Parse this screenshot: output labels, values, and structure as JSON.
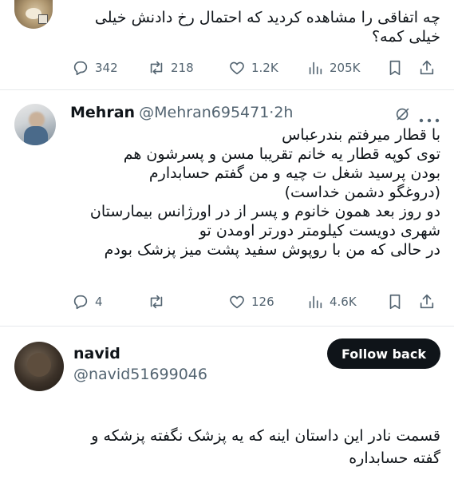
{
  "tweet1": {
    "text_line1": "چه اتفاقی را مشاهده کردید که احتمال رخ دادنش خیلی",
    "text_line2": "خیلی کمه؟",
    "replies": "342",
    "retweets": "218",
    "likes": "1.2K",
    "views": "205K"
  },
  "tweet2": {
    "name": "Mehran",
    "handle": "@Mehran695471",
    "dot": "·",
    "time": "2h",
    "lines": [
      "با قطار میرفتم بندرعباس",
      "توی کوپه قطار یه خانم تقریبا مسن و پسرشون هم",
      "بودن پرسید شغل ت چیه و من گفتم حسابدارم",
      "(دروغگو دشمن خداست)",
      "دو روز بعد همون خانوم و پسر از در اورژانس بیمارستان",
      "شهری دویست کیلومتر دورتر اومدن تو",
      "در حالی که من با روپوش سفید پشت میز پزشک بودم"
    ],
    "replies": "4",
    "retweets": "",
    "likes": "126",
    "views": "4.6K"
  },
  "tweet3": {
    "name": "navid",
    "handle": "@navid51699046",
    "follow_label": "Follow back",
    "text_line1": "قسمت نادر این داستان اینه که یه پزشک نگفته پزشکه و",
    "text_line2": "گفته حسابداره"
  },
  "icons": [
    "reply-icon",
    "retweet-icon",
    "like-icon",
    "views-icon",
    "bookmark-icon",
    "share-icon",
    "grok-icon",
    "more-icon"
  ],
  "colors": {
    "text": "#0f1419",
    "secondary": "#536471",
    "divider": "#e6e9eb",
    "button": "#0f1419"
  }
}
